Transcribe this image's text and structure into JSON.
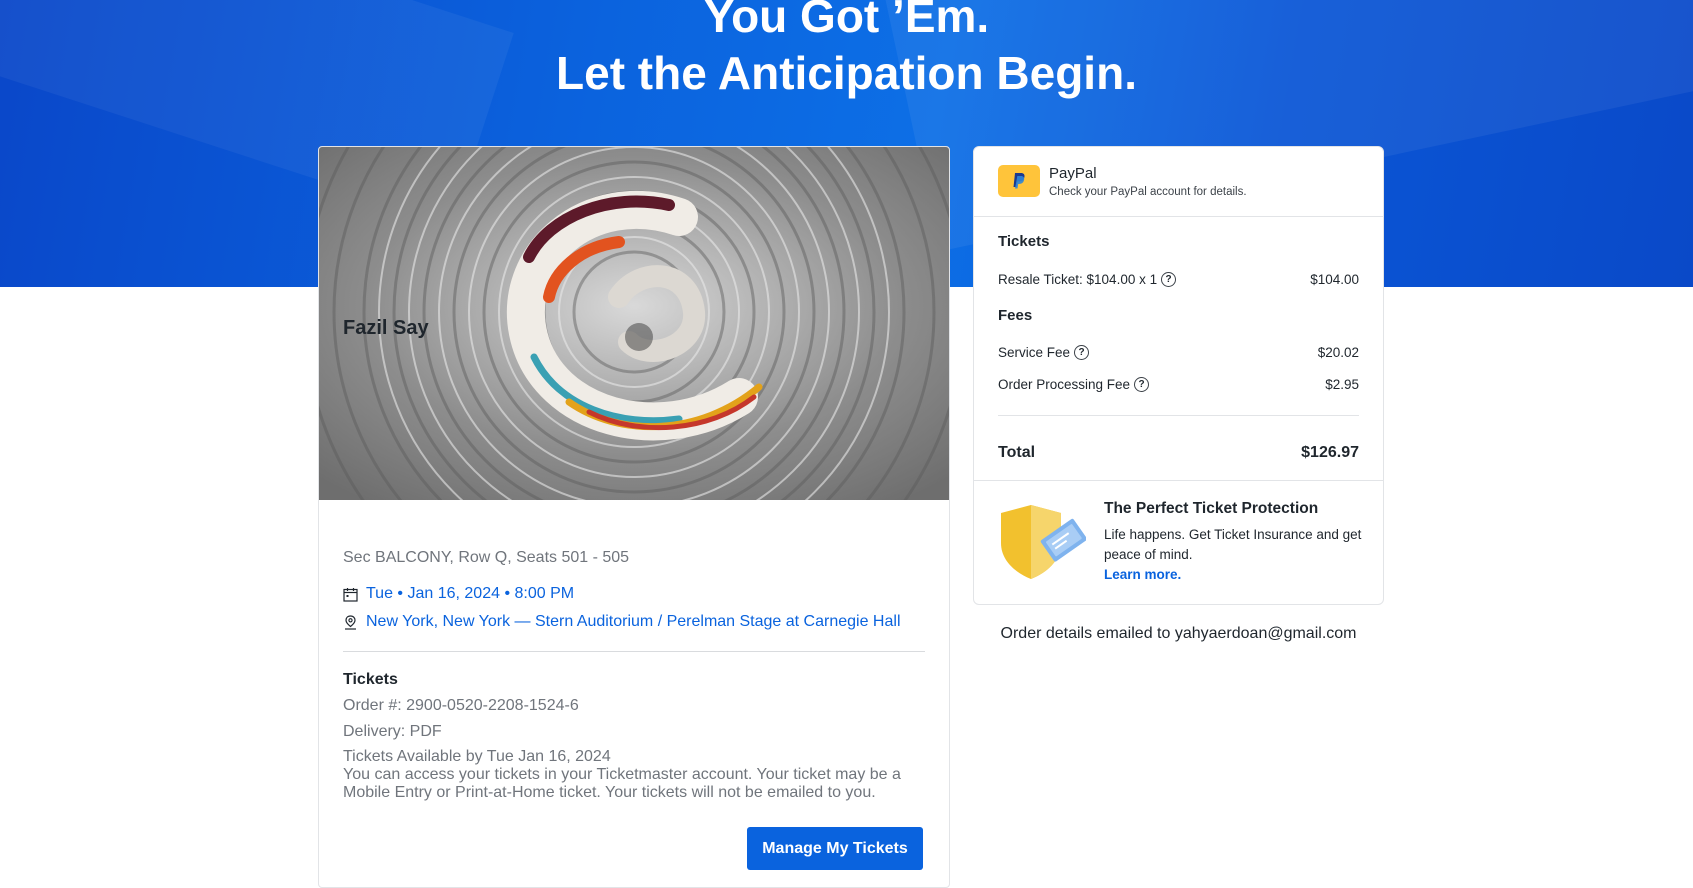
{
  "hero": {
    "line1": "You Got ’Em.",
    "line2": "Let the Anticipation Begin."
  },
  "event": {
    "artist": "Fazil Say",
    "seats": "Sec BALCONY, Row Q, Seats 501 - 505",
    "date": "Tue • Jan 16, 2024 • 8:00 PM",
    "venue": "New York, New York — Stern Auditorium / Perelman Stage at Carnegie Hall",
    "tickets_heading": "Tickets",
    "order_number": "Order #: 2900-0520-2208-1524-6",
    "delivery": "Delivery: PDF",
    "availability": "Tickets Available by Tue Jan 16, 2024",
    "access_note": "You can access your tickets in your Ticketmaster account. Your ticket may be a Mobile Entry or Print-at-Home ticket. Your tickets will not be emailed to you.",
    "manage_button": "Manage My Tickets",
    "icons": [
      "calendar-icon",
      "location-pin-icon"
    ]
  },
  "payment": {
    "method": "PayPal",
    "note": "Check your PayPal account for details.",
    "logo_color": "#ffc43a"
  },
  "summary": {
    "tickets_heading": "Tickets",
    "resale_label": "Resale Ticket: $104.00 x 1",
    "resale_amount": "$104.00",
    "fees_heading": "Fees",
    "service_fee_label": "Service Fee",
    "service_fee_amount": "$20.02",
    "processing_fee_label": "Order Processing Fee",
    "processing_fee_amount": "$2.95",
    "total_label": "Total",
    "total_amount": "$126.97",
    "help_glyph": "?"
  },
  "protection": {
    "title": "The Perfect Ticket Protection",
    "text": "Life happens. Get Ticket Insurance and get peace of mind.",
    "link": "Learn more."
  },
  "footer": {
    "emailed": "Order details emailed to yahyaerdoan@gmail.com"
  },
  "colors": {
    "brand_blue": "#0a63de",
    "hero_blue": "#0b5fdc",
    "muted_text": "#70757c"
  }
}
